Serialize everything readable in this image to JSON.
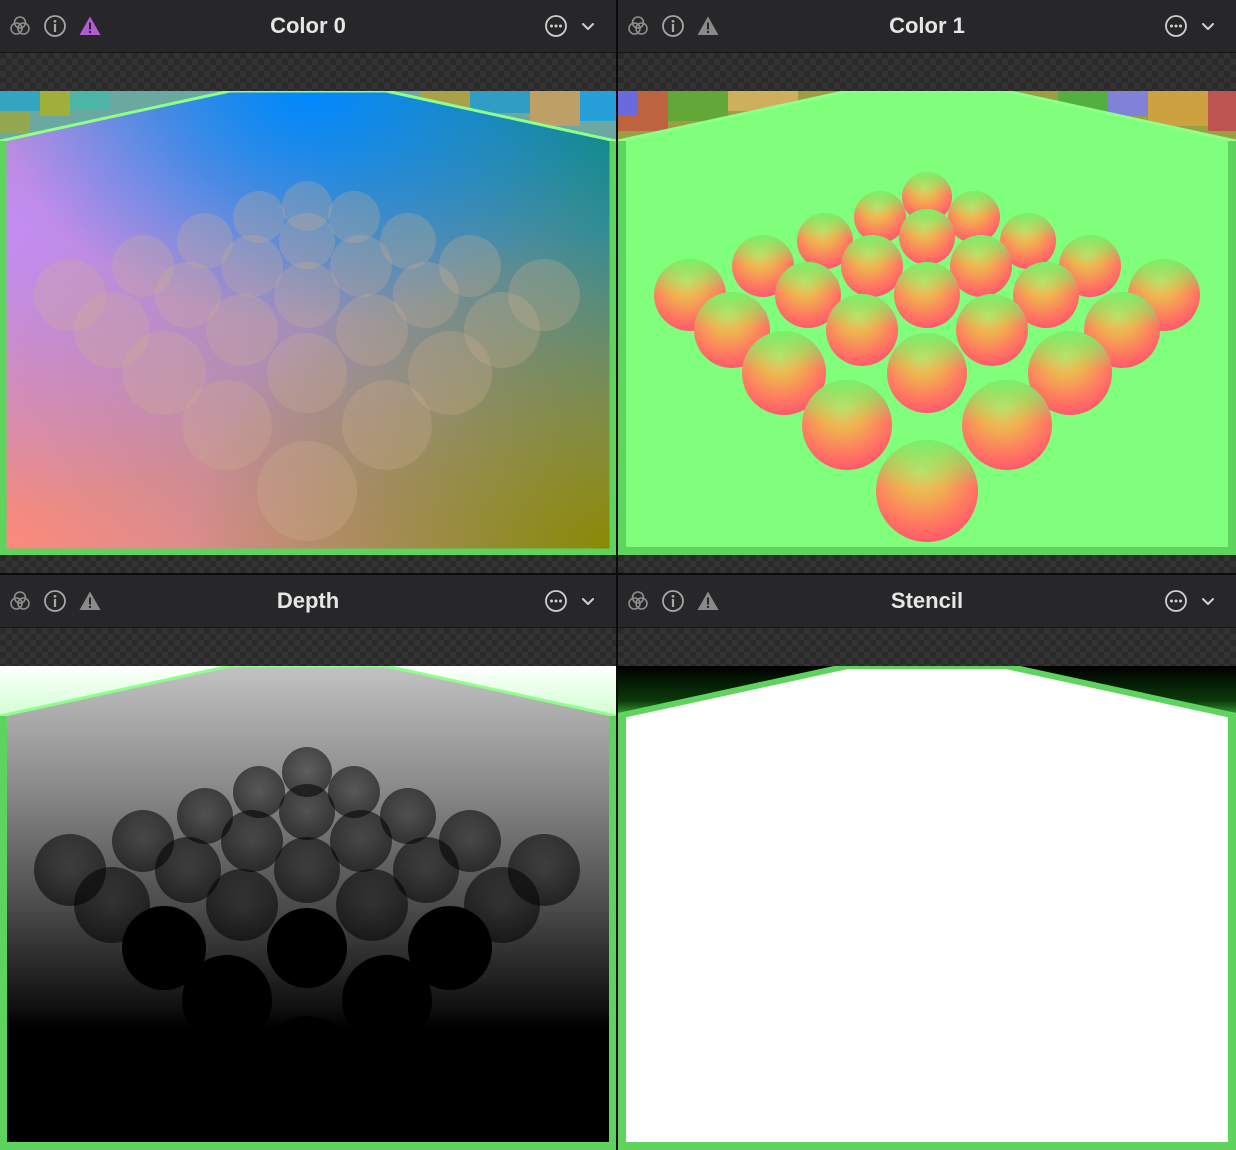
{
  "panels": [
    {
      "title": "Color 0",
      "warning_color": "#b25bd6"
    },
    {
      "title": "Color 1",
      "warning_color": "#8a8a8a"
    },
    {
      "title": "Depth",
      "warning_color": "#8a8a8a"
    },
    {
      "title": "Stencil",
      "warning_color": "#8a8a8a"
    }
  ],
  "icons": {
    "left": [
      "overlay-circles-icon",
      "info-icon",
      "warning-icon"
    ],
    "right": [
      "more-options-icon",
      "chevron-down-icon"
    ]
  },
  "colors": {
    "border_green": "#5ed35e",
    "color1_background": "#80ff7c",
    "stencil_fill": "#ffffff",
    "titlebar": "#272729"
  }
}
